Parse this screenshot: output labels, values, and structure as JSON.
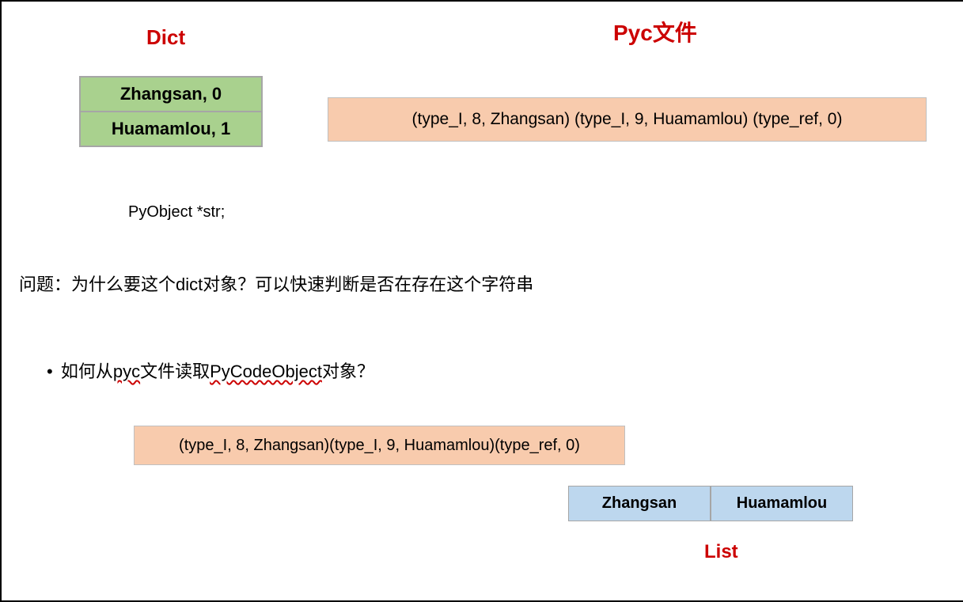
{
  "headers": {
    "dict": "Dict",
    "pyc": "Pyc文件",
    "list": "List"
  },
  "dict_table": {
    "row0": "Zhangsan, 0",
    "row1": "Huamamlou, 1"
  },
  "pyc_content_1": "(type_I, 8, Zhangsan) (type_I, 9, Huamamlou) (type_ref, 0)",
  "pyobject_decl": "PyObject *str;",
  "question": "问题：为什么要这个dict对象？可以快速判断是否在存在这个字符串",
  "bullet": {
    "prefix": "如何从",
    "spell": "pyc",
    "mid": "文件读取",
    "spell2": "PyCodeObject",
    "suffix": "对象？"
  },
  "pyc_content_2": "(type_I, 8, Zhangsan)(type_I, 9, Huamamlou)(type_ref, 0)",
  "list_table": {
    "cell0": "Zhangsan",
    "cell1": "Huamamlou"
  }
}
